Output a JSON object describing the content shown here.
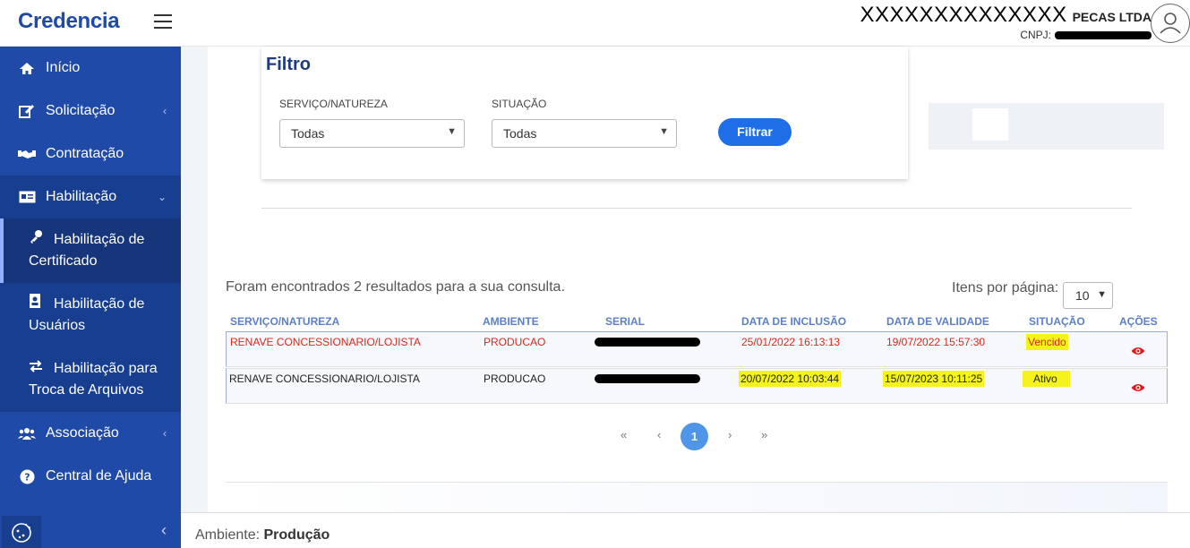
{
  "header": {
    "logo": "Credencia",
    "company_masked": "XXXXXXXXXXXXXX",
    "company_suffix": "PECAS LTDA",
    "cnpj_label": "CNPJ:"
  },
  "sidebar": {
    "items": [
      {
        "label": "Início",
        "icon": "home-icon"
      },
      {
        "label": "Solicitação",
        "icon": "edit-icon"
      },
      {
        "label": "Contratação",
        "icon": "handshake-icon"
      },
      {
        "label": "Habilitação",
        "icon": "id-card-icon"
      },
      {
        "label": "Associação",
        "icon": "users-icon"
      },
      {
        "label": "Central de Ajuda",
        "icon": "help-icon"
      }
    ],
    "subitems": [
      {
        "label": "Habilitação de Certificado",
        "icon": "key-icon"
      },
      {
        "label": "Habilitação de Usuários",
        "icon": "badge-icon"
      },
      {
        "label": "Habilitação para Troca de Arquivos",
        "icon": "exchange-icon"
      }
    ]
  },
  "filter": {
    "title": "Filtro",
    "servico_label": "SERVIÇO/NATUREZA",
    "servico_value": "Todas",
    "situacao_label": "SITUAÇÃO",
    "situacao_value": "Todas",
    "button": "Filtrar"
  },
  "results": {
    "summary": "Foram encontrados 2 resultados para a sua consulta.",
    "per_page_label": "Itens por página:",
    "per_page_value": "10"
  },
  "table": {
    "columns": [
      "SERVIÇO/NATUREZA",
      "AMBIENTE",
      "SERIAL",
      "DATA DE INCLUSÃO",
      "DATA DE VALIDADE",
      "SITUAÇÃO",
      "AÇÕES"
    ],
    "rows": [
      {
        "servico": "RENAVE CONCESSIONARIO/LOJISTA",
        "ambiente": "PRODUCAO",
        "inclusao": "25/01/2022 16:13:13",
        "validade": "19/07/2022 15:57:30",
        "situacao": "Vencido"
      },
      {
        "servico": "RENAVE CONCESSIONARIO/LOJISTA",
        "ambiente": "PRODUCAO",
        "inclusao": "20/07/2022 10:03:44",
        "validade": "15/07/2023 10:11:25",
        "situacao": "Ativo"
      }
    ]
  },
  "pagination": {
    "first": "«",
    "prev": "‹",
    "current": "1",
    "next": "›",
    "last": "»"
  },
  "footer": {
    "label": "Ambiente:",
    "value": "Produção"
  },
  "colors": {
    "sidebar": "#1f4aa8",
    "accent": "#1e6ee8",
    "expired": "#d9281c",
    "highlight": "#f4f41c"
  }
}
